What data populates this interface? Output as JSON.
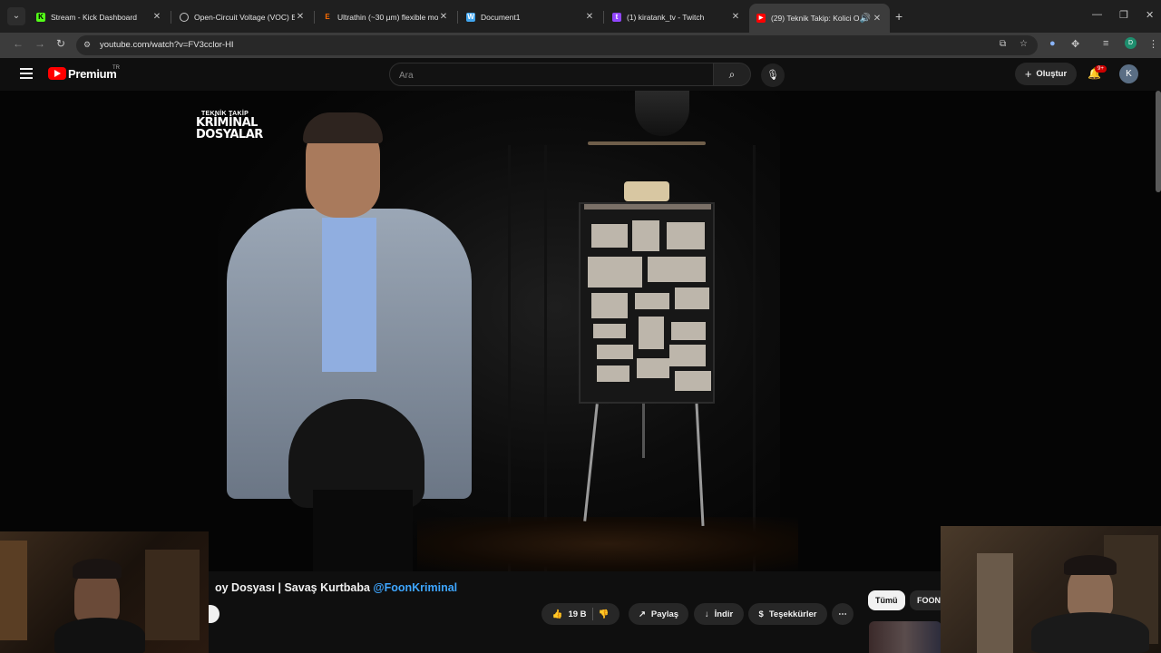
{
  "browser": {
    "tabs": [
      {
        "title": "Stream - Kick Dashboard",
        "favicon": "kick-icon",
        "active": false
      },
      {
        "title": "Open-Circuit Voltage (VOC) Ent",
        "favicon": "globe-icon",
        "active": false
      },
      {
        "title": "Ultrathin (~30 µm) flexible mo",
        "favicon": "elsevier-icon",
        "active": false
      },
      {
        "title": "Document1",
        "favicon": "word-icon",
        "active": false
      },
      {
        "title": "(1) kiratank_tv - Twitch",
        "favicon": "twitch-icon",
        "active": false
      },
      {
        "title": "(29) Teknik Takip: Kolici Or",
        "favicon": "youtube-icon",
        "active": true
      }
    ],
    "url": "youtube.com/watch?v=FV3cclor-HI",
    "profile_initial": "D"
  },
  "youtube": {
    "brand": "Premium",
    "country": "TR",
    "search_placeholder": "Ara",
    "create_label": "Oluştur",
    "notification_count": "9+",
    "avatar_initial": "K"
  },
  "video": {
    "logo_line1": "TEKNİK TAKİP",
    "logo_line2": "KRİMİNAL",
    "logo_line3": "DOSYALAR"
  },
  "info": {
    "title": "oy Dosyası | Savaş Kurtbaba ",
    "mention": "@FoonKriminal",
    "like_count": "19 B",
    "share_label": "Paylaş",
    "download_label": "İndir",
    "thanks_label": "Teşekkürler",
    "chips": [
      "Tümü",
      "FOON"
    ]
  },
  "colors": {
    "accent_red": "#ff0000",
    "link_blue": "#3ea6ff",
    "badge_red": "#cc0000"
  }
}
